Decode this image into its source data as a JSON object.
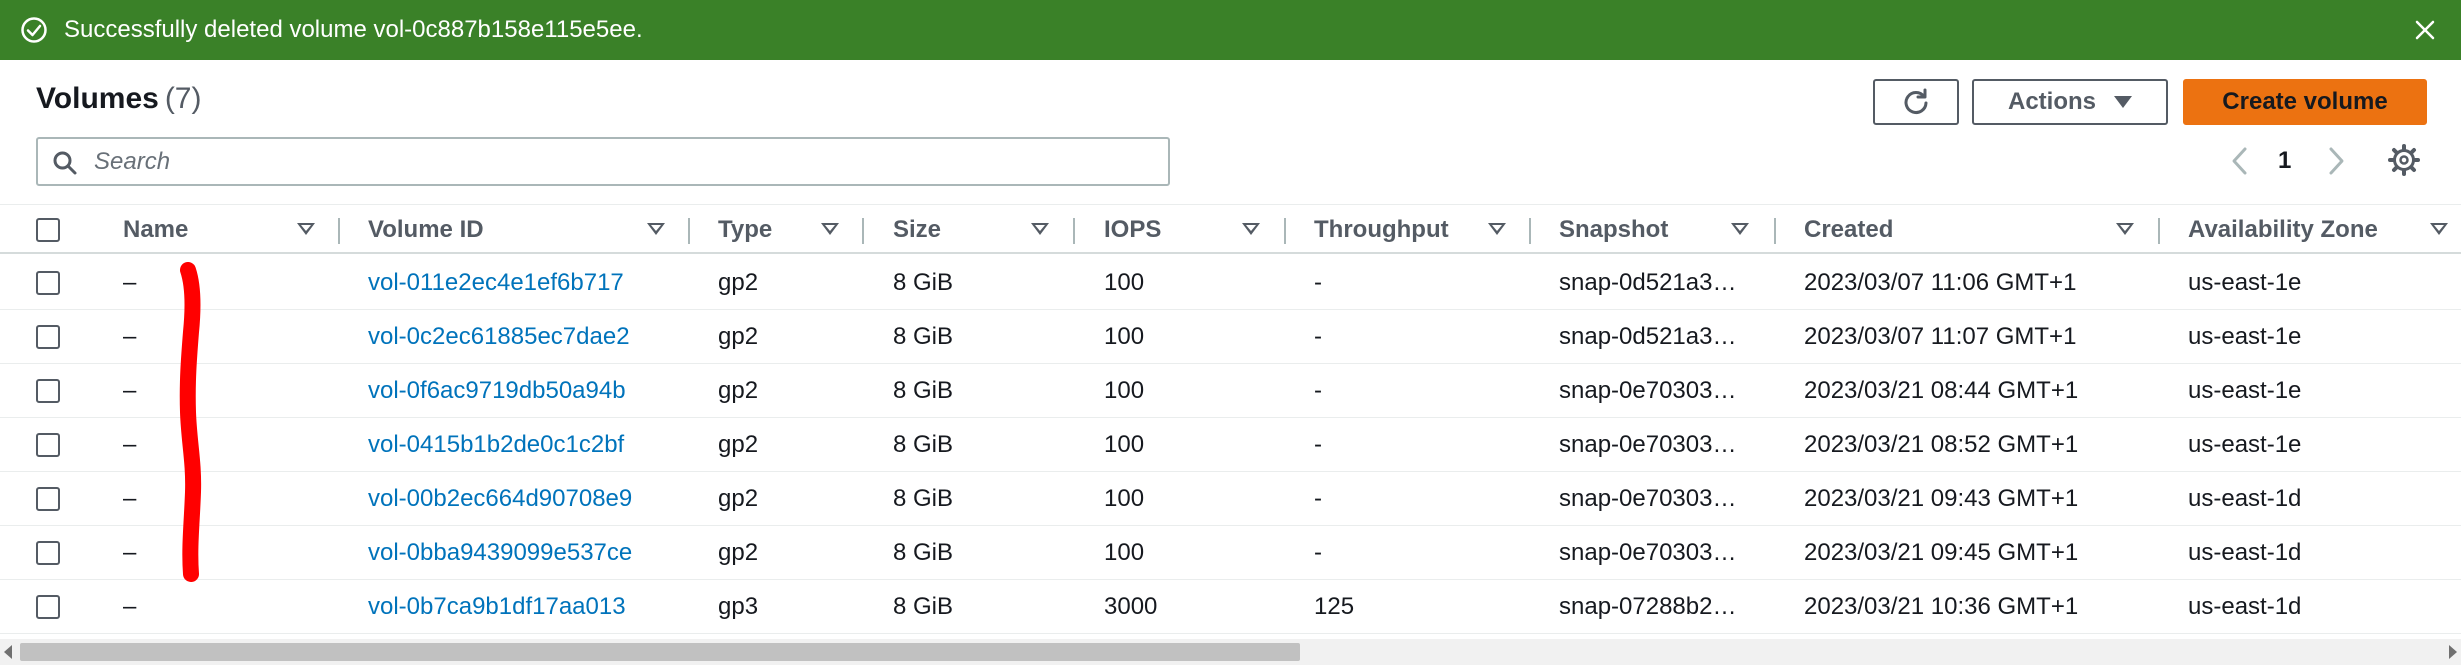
{
  "flash": {
    "message": "Successfully deleted volume vol-0c887b158e115e5ee.",
    "icon": "check-circle-icon",
    "close_icon": "close-icon",
    "color": "#3a8128"
  },
  "header": {
    "title": "Volumes",
    "count": "(7)",
    "actions_label": "Actions",
    "create_label": "Create volume",
    "refresh_icon": "refresh-icon"
  },
  "search": {
    "placeholder": "Search",
    "value": ""
  },
  "pagination": {
    "current_page": "1"
  },
  "table": {
    "columns": [
      "Name",
      "Volume ID",
      "Type",
      "Size",
      "IOPS",
      "Throughput",
      "Snapshot",
      "Created",
      "Availability Zone"
    ],
    "rows": [
      {
        "name": "–",
        "volume_id": "vol-011e2ec4e1ef6b717",
        "type": "gp2",
        "size": "8 GiB",
        "iops": "100",
        "throughput": "-",
        "snapshot": "snap-0d521a3…",
        "created": "2023/03/07 11:06 GMT+1",
        "az": "us-east-1e"
      },
      {
        "name": "–",
        "volume_id": "vol-0c2ec61885ec7dae2",
        "type": "gp2",
        "size": "8 GiB",
        "iops": "100",
        "throughput": "-",
        "snapshot": "snap-0d521a3…",
        "created": "2023/03/07 11:07 GMT+1",
        "az": "us-east-1e"
      },
      {
        "name": "–",
        "volume_id": "vol-0f6ac9719db50a94b",
        "type": "gp2",
        "size": "8 GiB",
        "iops": "100",
        "throughput": "-",
        "snapshot": "snap-0e70303…",
        "created": "2023/03/21 08:44 GMT+1",
        "az": "us-east-1e"
      },
      {
        "name": "–",
        "volume_id": "vol-0415b1b2de0c1c2bf",
        "type": "gp2",
        "size": "8 GiB",
        "iops": "100",
        "throughput": "-",
        "snapshot": "snap-0e70303…",
        "created": "2023/03/21 08:52 GMT+1",
        "az": "us-east-1e"
      },
      {
        "name": "–",
        "volume_id": "vol-00b2ec664d90708e9",
        "type": "gp2",
        "size": "8 GiB",
        "iops": "100",
        "throughput": "-",
        "snapshot": "snap-0e70303…",
        "created": "2023/03/21 09:43 GMT+1",
        "az": "us-east-1d"
      },
      {
        "name": "–",
        "volume_id": "vol-0bba9439099e537ce",
        "type": "gp2",
        "size": "8 GiB",
        "iops": "100",
        "throughput": "-",
        "snapshot": "snap-0e70303…",
        "created": "2023/03/21 09:45 GMT+1",
        "az": "us-east-1d"
      },
      {
        "name": "–",
        "volume_id": "vol-0b7ca9b1df17aa013",
        "type": "gp3",
        "size": "8 GiB",
        "iops": "3000",
        "throughput": "125",
        "snapshot": "snap-07288b2…",
        "created": "2023/03/21 10:36 GMT+1",
        "az": "us-east-1d"
      }
    ]
  },
  "colors": {
    "accent": "#ec7211",
    "link": "#0073bb",
    "success": "#3a8128",
    "annotation": "#ff0000"
  }
}
